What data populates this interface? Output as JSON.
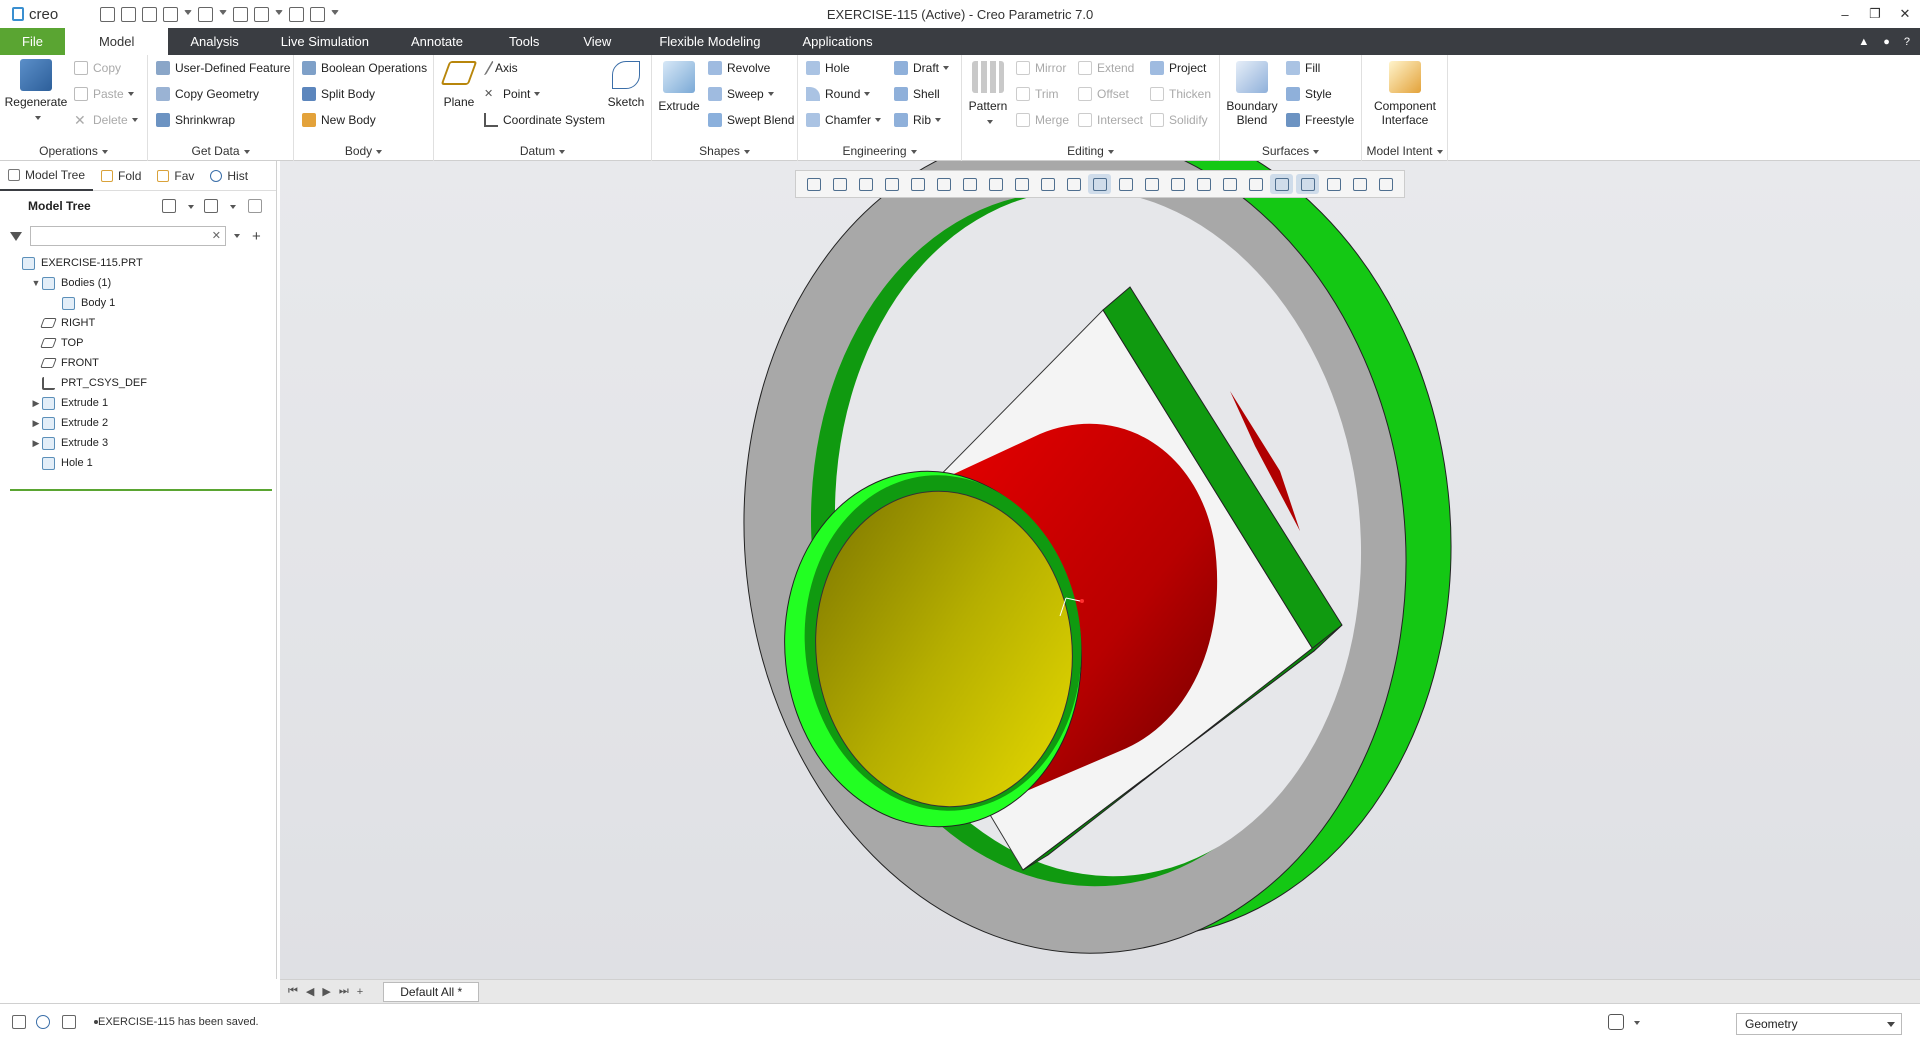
{
  "window": {
    "brand": "creo",
    "title": "EXERCISE-115 (Active) - Creo Parametric 7.0",
    "controls": [
      "–",
      "❐",
      "✕"
    ]
  },
  "menubar": {
    "tabs": [
      {
        "label": "File"
      },
      {
        "label": "Model"
      },
      {
        "label": "Analysis"
      },
      {
        "label": "Live Simulation"
      },
      {
        "label": "Annotate"
      },
      {
        "label": "Tools"
      },
      {
        "label": "View"
      },
      {
        "label": "Flexible Modeling"
      },
      {
        "label": "Applications"
      }
    ],
    "active": "Model",
    "right_icons": [
      "▲",
      "●",
      "?"
    ]
  },
  "ribbon": {
    "operations": {
      "group": "Operations",
      "regenerate": "Regenerate",
      "copy": "Copy",
      "paste": "Paste",
      "delete": "Delete"
    },
    "get_data": {
      "group": "Get Data",
      "udf": "User-Defined Feature",
      "copy_geometry": "Copy Geometry",
      "shrinkwrap": "Shrinkwrap"
    },
    "body": {
      "group": "Body",
      "boolean": "Boolean Operations",
      "split": "Split Body",
      "new": "New Body"
    },
    "datum": {
      "group": "Datum",
      "plane": "Plane",
      "axis": "Axis",
      "point": "Point",
      "csys": "Coordinate System",
      "sketch": "Sketch"
    },
    "shapes": {
      "group": "Shapes",
      "extrude": "Extrude",
      "revolve": "Revolve",
      "sweep": "Sweep",
      "swept_blend": "Swept Blend"
    },
    "engineering": {
      "group": "Engineering",
      "hole": "Hole",
      "round": "Round",
      "chamfer": "Chamfer",
      "draft": "Draft",
      "shell": "Shell",
      "rib": "Rib"
    },
    "editing": {
      "group": "Editing",
      "pattern": "Pattern",
      "mirror": "Mirror",
      "trim": "Trim",
      "merge": "Merge",
      "extend": "Extend",
      "offset": "Offset",
      "intersect": "Intersect",
      "project": "Project",
      "thicken": "Thicken",
      "solidify": "Solidify"
    },
    "surfaces": {
      "group": "Surfaces",
      "boundary_blend": "Boundary Blend",
      "fill": "Fill",
      "style": "Style",
      "freestyle": "Freestyle"
    },
    "model_intent": {
      "group": "Model Intent",
      "component_interface": "Component Interface"
    }
  },
  "panel": {
    "tabs": [
      "Model Tree",
      "Fold",
      "Fav",
      "Hist"
    ],
    "header": "Model Tree",
    "search_placeholder": "",
    "tree": [
      {
        "label": "EXERCISE-115.PRT",
        "indent": 0,
        "twisty": "",
        "icon": "part"
      },
      {
        "label": "Bodies (1)",
        "indent": 1,
        "twisty": "▼",
        "icon": "bodies"
      },
      {
        "label": "Body 1",
        "indent": 2,
        "twisty": "",
        "icon": "body"
      },
      {
        "label": "RIGHT",
        "indent": 1,
        "twisty": "",
        "icon": "plane"
      },
      {
        "label": "TOP",
        "indent": 1,
        "twisty": "",
        "icon": "plane"
      },
      {
        "label": "FRONT",
        "indent": 1,
        "twisty": "",
        "icon": "plane"
      },
      {
        "label": "PRT_CSYS_DEF",
        "indent": 1,
        "twisty": "",
        "icon": "csys"
      },
      {
        "label": "Extrude 1",
        "indent": 1,
        "twisty": "▶",
        "icon": "extrude"
      },
      {
        "label": "Extrude 2",
        "indent": 1,
        "twisty": "▶",
        "icon": "extrude"
      },
      {
        "label": "Extrude 3",
        "indent": 1,
        "twisty": "▶",
        "icon": "extrude"
      },
      {
        "label": "Hole 1",
        "indent": 1,
        "twisty": "",
        "icon": "hole"
      }
    ]
  },
  "nav": {
    "tab": "Default All *"
  },
  "status": {
    "message": "EXERCISE-115 has been saved.",
    "filter": "Geometry"
  },
  "colors": {
    "accent": "#5aa532",
    "menubar": "#3a3d42",
    "green": "#14c814",
    "red": "#cc0000",
    "yellow": "#c8c000",
    "gray": "#a8a8a8"
  }
}
